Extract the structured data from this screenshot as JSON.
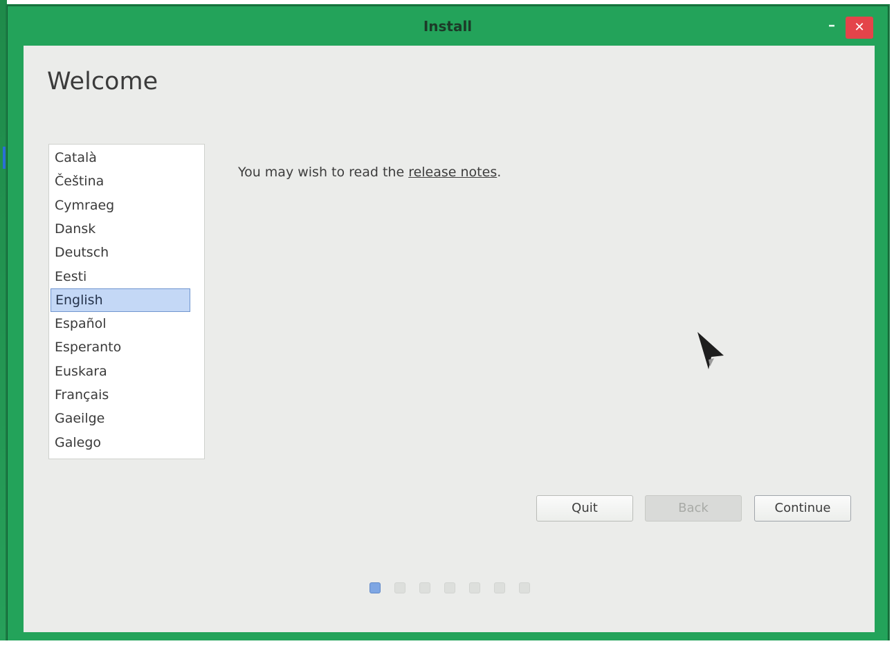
{
  "window": {
    "title": "Install",
    "minimize_glyph": "–",
    "close_glyph": "✕"
  },
  "taskbar": {
    "tab_glyph": "x"
  },
  "page": {
    "heading": "Welcome",
    "release_prefix": "You may wish to read the ",
    "release_link": "release notes",
    "release_suffix": "."
  },
  "languages": {
    "items": [
      {
        "label": "Català",
        "selected": false
      },
      {
        "label": "Čeština",
        "selected": false
      },
      {
        "label": "Cymraeg",
        "selected": false
      },
      {
        "label": "Dansk",
        "selected": false
      },
      {
        "label": "Deutsch",
        "selected": false
      },
      {
        "label": "Eesti",
        "selected": false
      },
      {
        "label": "English",
        "selected": true
      },
      {
        "label": "Español",
        "selected": false
      },
      {
        "label": "Esperanto",
        "selected": false
      },
      {
        "label": "Euskara",
        "selected": false
      },
      {
        "label": "Français",
        "selected": false
      },
      {
        "label": "Gaeilge",
        "selected": false
      },
      {
        "label": "Galego",
        "selected": false
      }
    ]
  },
  "buttons": {
    "quit": "Quit",
    "back": "Back",
    "continue": "Continue"
  },
  "progress": {
    "total_steps": 7,
    "current_step": 1
  },
  "colors": {
    "window_frame": "#23a35a",
    "client_bg": "#ebecea",
    "selection": "#c4d8f6",
    "close_button": "#e4444a",
    "active_dot": "#7ea6e3"
  }
}
